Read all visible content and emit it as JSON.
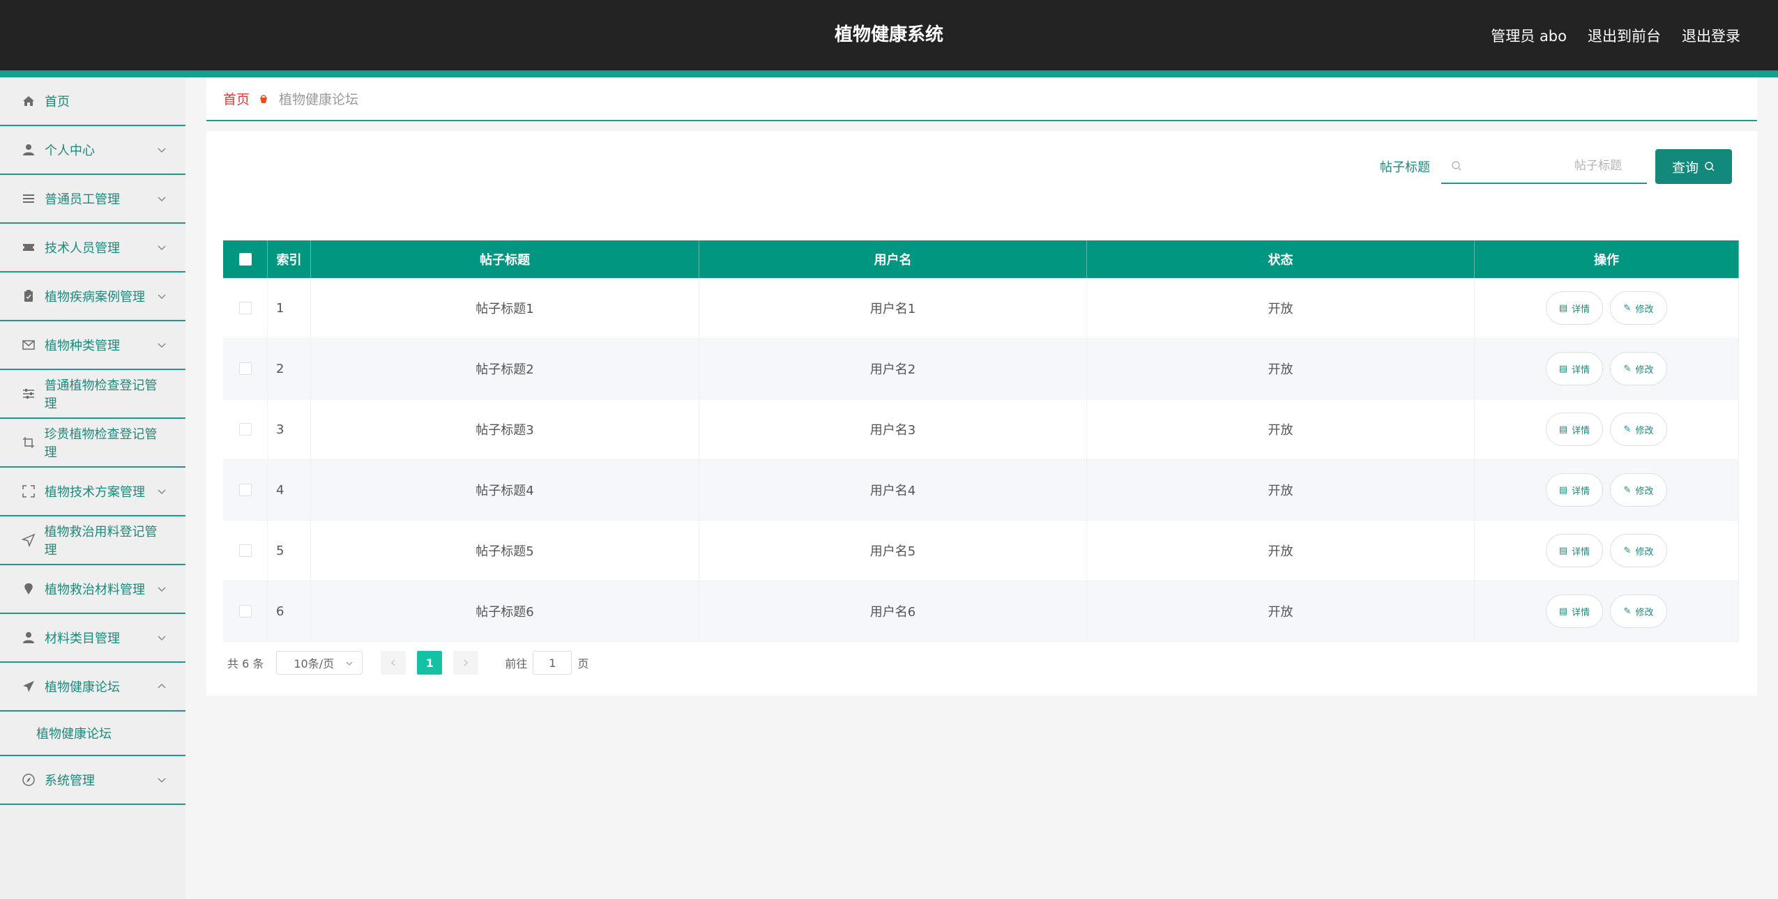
{
  "header": {
    "title": "植物健康系统",
    "admin_label": "管理员 abo",
    "front_label": "退出到前台",
    "logout_label": "退出登录"
  },
  "sidebar": {
    "items": [
      {
        "label": "首页",
        "icon": "home-icon"
      },
      {
        "label": "个人中心",
        "icon": "user-icon"
      },
      {
        "label": "普通员工管理",
        "icon": "list-icon"
      },
      {
        "label": "技术人员管理",
        "icon": "ticket-icon"
      },
      {
        "label": "植物疾病案例管理",
        "icon": "clipboard-icon"
      },
      {
        "label": "植物种类管理",
        "icon": "mail-icon"
      },
      {
        "label": "普通植物检查登记管理",
        "icon": "sliders-icon"
      },
      {
        "label": "珍贵植物检查登记管理",
        "icon": "crop-icon"
      },
      {
        "label": "植物技术方案管理",
        "icon": "fullscreen-icon"
      },
      {
        "label": "植物救治用料登记管理",
        "icon": "navigation-icon"
      },
      {
        "label": "植物救治材料管理",
        "icon": "marker-icon"
      },
      {
        "label": "材料类目管理",
        "icon": "user-icon"
      },
      {
        "label": "植物健康论坛",
        "icon": "paper-plane-icon"
      },
      {
        "label": "系统管理",
        "icon": "compass-icon"
      }
    ],
    "sub_item": "植物健康论坛"
  },
  "breadcrumb": {
    "home": "首页",
    "current": "植物健康论坛"
  },
  "search": {
    "label": "帖子标题",
    "placeholder": "帖子标题",
    "value": "",
    "button_label": "查询"
  },
  "table": {
    "columns": [
      "索引",
      "帖子标题",
      "用户名",
      "状态",
      "操作"
    ],
    "rows": [
      {
        "index": "1",
        "title": "帖子标题1",
        "user": "用户名1",
        "status": "开放"
      },
      {
        "index": "2",
        "title": "帖子标题2",
        "user": "用户名2",
        "status": "开放"
      },
      {
        "index": "3",
        "title": "帖子标题3",
        "user": "用户名3",
        "status": "开放"
      },
      {
        "index": "4",
        "title": "帖子标题4",
        "user": "用户名4",
        "status": "开放"
      },
      {
        "index": "5",
        "title": "帖子标题5",
        "user": "用户名5",
        "status": "开放"
      },
      {
        "index": "6",
        "title": "帖子标题6",
        "user": "用户名6",
        "status": "开放"
      }
    ],
    "detail_label": "详情",
    "edit_label": "修改"
  },
  "pagination": {
    "total": "共 6 条",
    "page_size": "10条/页",
    "current_page": "1",
    "goto_label": "前往",
    "goto_value": "1",
    "goto_suffix": "页"
  },
  "colors": {
    "primary": "#13897b",
    "header_bg": "#232323",
    "accent_bar": "#13a08e",
    "breadcrumb_home": "#e53935"
  }
}
